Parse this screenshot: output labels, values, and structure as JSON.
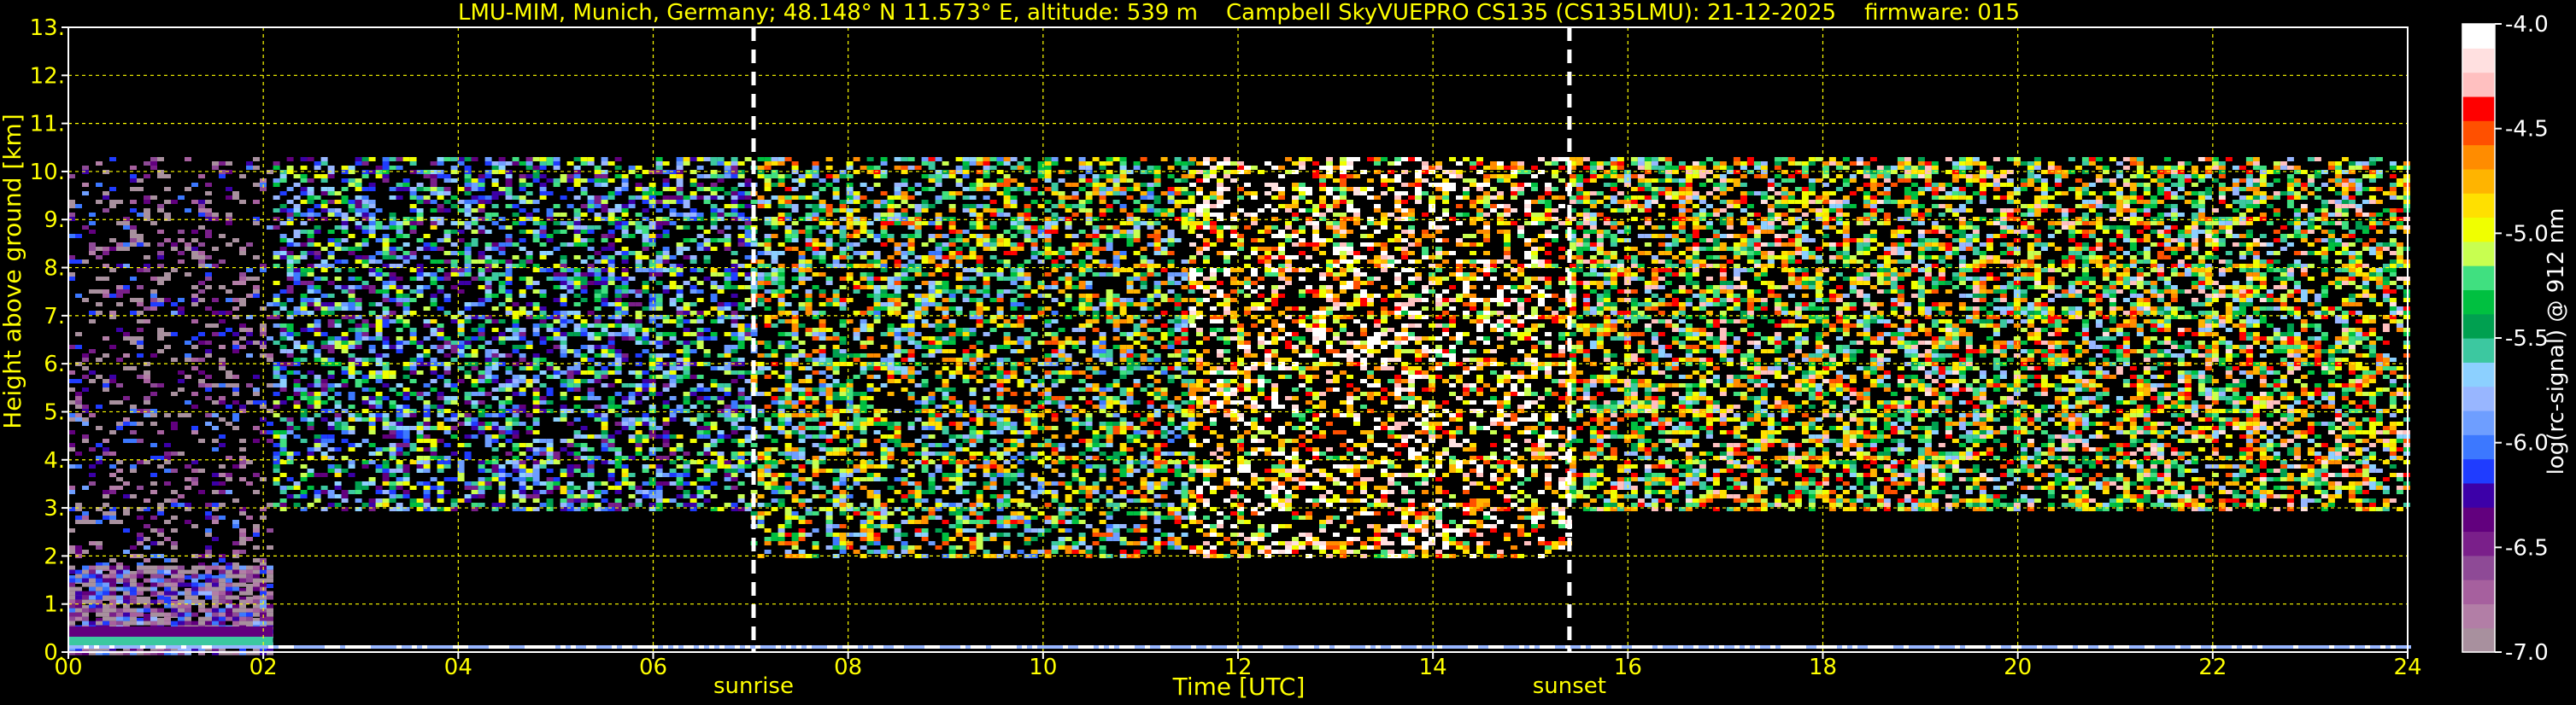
{
  "chart_data": {
    "type": "heatmap",
    "title": "LMU-MIM, Munich, Germany; 48.148° N 11.573° E, altitude: 539 m    Campbell SkyVUEPRO CS135 (CS135LMU): 21-12-2025    firmware: 015",
    "xlabel": "Time [UTC]",
    "ylabel": "Height above ground [km]",
    "xlim": [
      0,
      24
    ],
    "ylim": [
      0,
      13
    ],
    "xticks": [
      0,
      2,
      4,
      6,
      8,
      10,
      12,
      14,
      16,
      18,
      20,
      22,
      24
    ],
    "xtick_labels": [
      "00",
      "02",
      "04",
      "06",
      "08",
      "10",
      "12",
      "14",
      "16",
      "18",
      "20",
      "22",
      "24"
    ],
    "yticks": [
      0,
      1,
      2,
      3,
      4,
      5,
      6,
      7,
      8,
      9,
      10,
      11,
      12,
      13
    ],
    "ytick_labels": [
      "0.",
      "1.",
      "2.",
      "3.",
      "4.",
      "5.",
      "6.",
      "7.",
      "8.",
      "9.",
      "10.",
      "11.",
      "12.",
      "13."
    ],
    "grid": true,
    "grid_color": "#ffff00",
    "text_color": "#ffff00",
    "background": "#000000",
    "markers": [
      {
        "label": "sunrise",
        "x": 7.03
      },
      {
        "label": "sunset",
        "x": 15.4
      }
    ],
    "colorbar": {
      "label": "log(rc-signal) @ 912 nm",
      "range": [
        -7.0,
        -4.0
      ],
      "ticks": [
        -7.0,
        -6.5,
        -6.0,
        -5.5,
        -5.0,
        -4.5,
        -4.0
      ],
      "tick_labels": [
        "-7.0",
        "-6.5",
        "-6.0",
        "-5.5",
        "-5.0",
        "-4.5",
        "-4.0"
      ],
      "colors": [
        "#a8909e",
        "#b27ea6",
        "#a6609e",
        "#8e4a96",
        "#7a1f8a",
        "#62007e",
        "#3c00a8",
        "#1f3cff",
        "#3c78ff",
        "#6e9eff",
        "#98b6ff",
        "#8cd0ff",
        "#3cc8a0",
        "#00a050",
        "#00c040",
        "#40e080",
        "#c8ff50",
        "#f0ff00",
        "#ffe000",
        "#ffb400",
        "#ff8c00",
        "#ff5000",
        "#ff0000",
        "#ffc0c0",
        "#ffe0e0",
        "#ffffff"
      ]
    },
    "signal_regions": [
      {
        "x0": 0.0,
        "x1": 2.1,
        "y0": 0.0,
        "y1": 10.3,
        "level": -6.7,
        "density": 0.25
      },
      {
        "x0": 0.0,
        "x1": 2.1,
        "y0": 0.0,
        "y1": 1.8,
        "level": -6.6,
        "density": 0.85
      },
      {
        "x0": 2.1,
        "x1": 7.0,
        "y0": 3.0,
        "y1": 10.3,
        "level": -5.7,
        "density": 0.5
      },
      {
        "x0": 7.0,
        "x1": 11.5,
        "y0": 2.0,
        "y1": 10.3,
        "level": -5.2,
        "density": 0.5
      },
      {
        "x0": 11.5,
        "x1": 15.4,
        "y0": 2.0,
        "y1": 10.3,
        "level": -4.5,
        "density": 0.45
      },
      {
        "x0": 15.4,
        "x1": 24.0,
        "y0": 3.0,
        "y1": 10.3,
        "level": -5.0,
        "density": 0.55
      }
    ]
  }
}
